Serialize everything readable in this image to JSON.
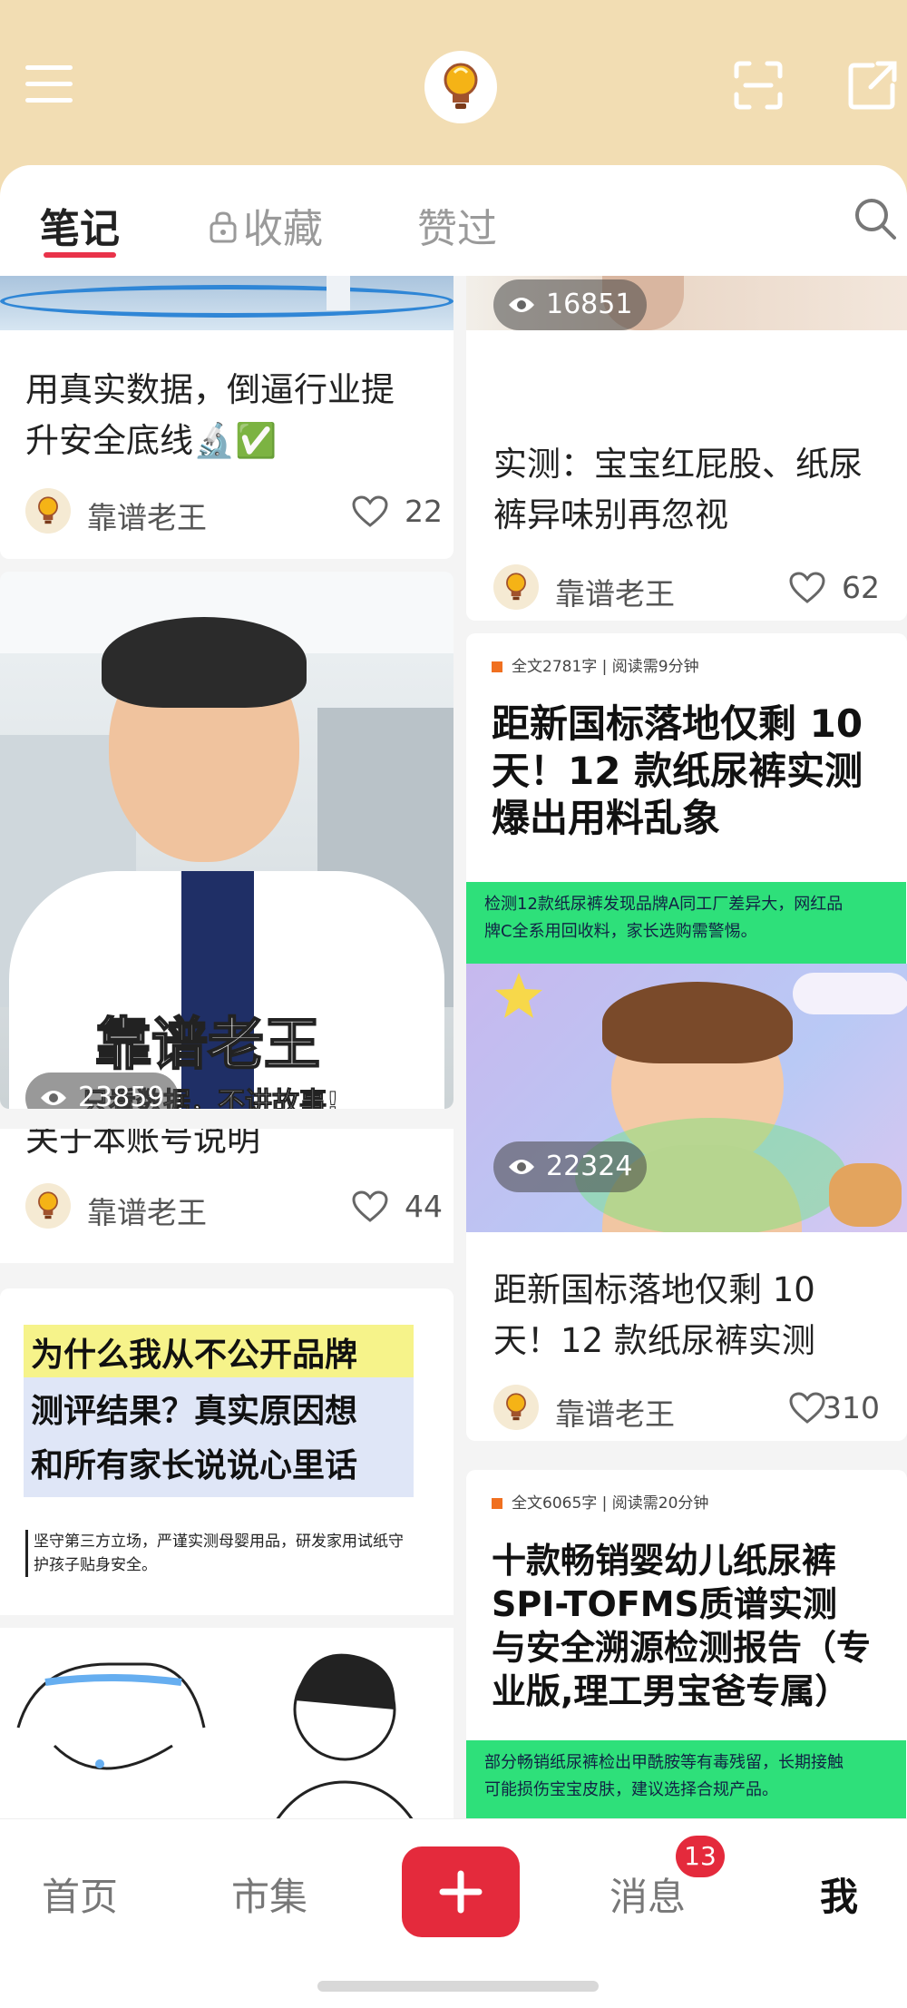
{
  "header": {
    "avatar_icon": "lightbulb-icon",
    "scan_icon": "scan-icon",
    "share_icon": "share-icon"
  },
  "tabs": [
    {
      "label": "笔记",
      "active": true
    },
    {
      "label": "收藏",
      "icon": "lock-icon"
    },
    {
      "label": "赞过"
    }
  ],
  "left_column": {
    "card1": {
      "title_line1": "用真实数据，倒逼行业提",
      "title_line2": "升安全底线🔬✅",
      "author": "靠谱老王",
      "likes": "22"
    },
    "card2": {
      "image_text_main": "靠谱老王",
      "image_text_sub": "只看数据，不讲故事!",
      "views": "23859",
      "title": "关于本账号说明",
      "author": "靠谱老王",
      "likes": "44"
    },
    "card3": {
      "heading_line1": "为什么我从不公开品牌",
      "heading_line2": "测评结果？真实原因想",
      "heading_line3": "和所有家长说说心里话",
      "sub_line1": "坚守第三方立场，严谨实测母婴用品，研发家用试纸守",
      "sub_line2": "护孩子贴身安全。"
    }
  },
  "right_column": {
    "card1": {
      "views": "16851",
      "title_line1": "实测：宝宝红屁股、纸尿",
      "title_line2": "裤异味别再忽视",
      "author": "靠谱老王",
      "likes": "62"
    },
    "card2": {
      "meta": "全文2781字 | 阅读需9分钟",
      "headline_line1": "距新国标落地仅剩 10",
      "headline_line2": "天！12 款纸尿裤实测",
      "headline_line3": "爆出用料乱象",
      "green_line1": "检测12款纸尿裤发现品牌A同工厂差异大，网红品",
      "green_line2": "牌C全系用回收料，家长选购需警惕。",
      "views": "22324",
      "title_line1": "距新国标落地仅剩 10",
      "title_line2": "天！12 款纸尿裤实测",
      "author": "靠谱老王",
      "likes": "310"
    },
    "card3": {
      "meta": "全文6065字 | 阅读需20分钟",
      "headline_line1": "十款畅销婴幼儿纸尿裤",
      "headline_line2": "SPI-TOFMS质谱实测",
      "headline_line3": "与安全溯源检测报告（专",
      "headline_line4": "业版,理工男宝爸专属）",
      "green_line1": "部分畅销纸尿裤检出甲酰胺等有毒残留，长期接触",
      "green_line2": "可能损伤宝宝皮肤，建议选择合规产品。"
    }
  },
  "bottom_nav": {
    "home": "首页",
    "market": "市集",
    "add_icon": "plus-icon",
    "messages": "消息",
    "messages_badge": "13",
    "me": "我"
  },
  "colors": {
    "accent": "#e42a3c",
    "header_bg": "#f2ddb3",
    "green_bar": "#2ee07a"
  }
}
